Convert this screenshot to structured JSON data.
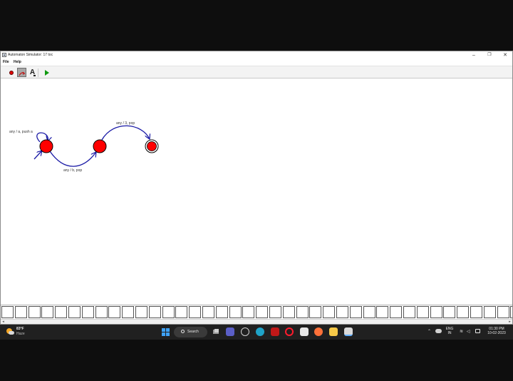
{
  "window": {
    "title": "Automaton Simulator: 17 toc",
    "app_icon": "automaton-app-icon",
    "controls": {
      "minimize": "–",
      "maximize": "❐",
      "close": "✕"
    }
  },
  "menubar": {
    "items": [
      {
        "label": "File"
      },
      {
        "label": "Help"
      }
    ]
  },
  "toolbar": {
    "tools": [
      {
        "name": "add-state-tool",
        "icon": "red-circle-icon"
      },
      {
        "name": "add-transition-tool",
        "icon": "transition-arrow-icon",
        "selected": true
      },
      {
        "name": "add-text-tool",
        "icon": "text-a-icon",
        "glyph": "A"
      },
      {
        "name": "run-simulation-tool",
        "icon": "green-play-icon"
      }
    ]
  },
  "automaton": {
    "states": [
      {
        "id": "q0",
        "initial": true,
        "accepting": false
      },
      {
        "id": "q1",
        "initial": false,
        "accepting": false
      },
      {
        "id": "q2",
        "initial": false,
        "accepting": true
      }
    ],
    "transitions": [
      {
        "from": "q0",
        "to": "q0",
        "label": "any / a, push a"
      },
      {
        "from": "q0",
        "to": "q1",
        "label": "any / b, pop"
      },
      {
        "from": "q1",
        "to": "q2",
        "label": "any / 3, pop"
      }
    ],
    "colors": {
      "state_fill": "#ff0000",
      "state_stroke": "#000000",
      "transition": "#1a1aa6"
    }
  },
  "tape": {
    "cell_count": 39,
    "cells": []
  },
  "taskbar": {
    "weather": {
      "temp": "83°F",
      "condition": "Haze"
    },
    "search": {
      "placeholder": "Search"
    },
    "apps": [
      {
        "name": "task-view",
        "icon": "task-view-icon"
      },
      {
        "name": "teams",
        "icon": "teams-icon"
      },
      {
        "name": "dell",
        "icon": "dell-icon"
      },
      {
        "name": "edge",
        "icon": "edge-icon"
      },
      {
        "name": "mcafee",
        "icon": "mcafee-icon"
      },
      {
        "name": "opera",
        "icon": "opera-icon"
      },
      {
        "name": "store",
        "icon": "store-icon"
      },
      {
        "name": "firefox",
        "icon": "firefox-icon"
      },
      {
        "name": "file-explorer",
        "icon": "folder-icon"
      },
      {
        "name": "java-app",
        "icon": "java-icon"
      }
    ],
    "tray": {
      "lang": "ENG",
      "region": "IN",
      "time": "01:30 PM",
      "date": "10-02-2023"
    }
  }
}
